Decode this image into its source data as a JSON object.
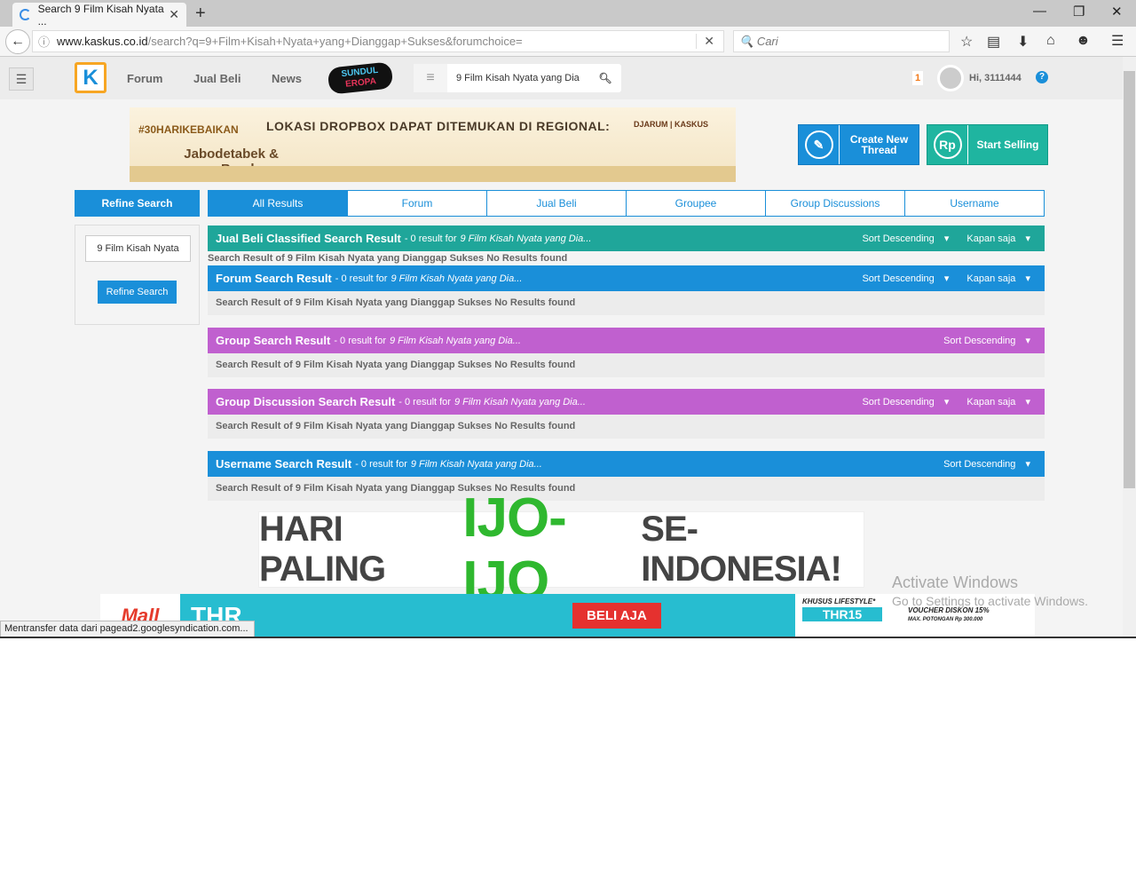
{
  "browser": {
    "tab_title": "Search 9 Film Kisah Nyata ...",
    "url_domain": "www.kaskus.co.id",
    "url_path": "/search?q=9+Film+Kisah+Nyata+yang+Dianggap+Sukses&forumchoice=",
    "search_placeholder": "Cari",
    "status": "Mentransfer data dari pagead2.googlesyndication.com..."
  },
  "header": {
    "nav": [
      "Forum",
      "Jual Beli",
      "News"
    ],
    "promo_logo": "SUNDUL EROPA",
    "search_value": "9 Film Kisah Nyata yang Dia",
    "notif_count": "1",
    "greeting": "Hi, 3111444",
    "help": "?"
  },
  "banner": {
    "tag": "#30HARIKEBAIKAN",
    "headline": "LOKASI DROPBOX DAPAT DITEMUKAN DI REGIONAL:",
    "location": "Jabodetabek & Bandung",
    "sponsor": "DJARUM | KASKUS"
  },
  "actions": {
    "create": "Create New Thread",
    "sell": "Start Selling"
  },
  "refine": {
    "title": "Refine Search",
    "input_value": "9 Film Kisah Nyata",
    "button": "Refine Search"
  },
  "tabs": [
    "All Results",
    "Forum",
    "Jual Beli",
    "Groupee",
    "Group Discussions",
    "Username"
  ],
  "sections": [
    {
      "title": "Jual Beli Classified Search Result",
      "count": "- 0 result for",
      "query": "9 Film Kisah Nyata yang Dia...",
      "sort": "Sort Descending",
      "time": "Kapan saja",
      "body": "Search Result of 9 Film Kisah Nyata yang Dianggap Sukses No Results found",
      "color": "#1fa69a"
    },
    {
      "title": "Forum Search Result",
      "count": "- 0 result for",
      "query": "9 Film Kisah Nyata yang Dia...",
      "sort": "Sort Descending",
      "time": "Kapan saja",
      "body": "Search Result of 9 Film Kisah Nyata yang Dianggap Sukses No Results found",
      "color": "#1a8fd9"
    },
    {
      "title": "Group Search Result",
      "count": "- 0 result for",
      "query": "9 Film Kisah Nyata yang Dia...",
      "sort": "Sort Descending",
      "body": "Search Result of 9 Film Kisah Nyata yang Dianggap Sukses No Results found",
      "color": "#c060cf"
    },
    {
      "title": "Group Discussion Search Result",
      "count": "- 0 result for",
      "query": "9 Film Kisah Nyata yang Dia...",
      "sort": "Sort Descending",
      "time": "Kapan saja",
      "body": "Search Result of 9 Film Kisah Nyata yang Dianggap Sukses No Results found",
      "color": "#c060cf"
    },
    {
      "title": "Username Search Result",
      "count": "- 0 result for",
      "query": "9 Film Kisah Nyata yang Dia...",
      "sort": "Sort Descending",
      "body": "Search Result of 9 Film Kisah Nyata yang Dianggap Sukses No Results found",
      "color": "#1a8fd9"
    }
  ],
  "ad2": {
    "a": "HARI PALING",
    "b": "IJO-IJO",
    "c": "SE-INDONESIA!"
  },
  "bottom_ad": {
    "brand": "Mall",
    "thr": "THR",
    "cta": "BELI AJA",
    "lifestyle": "KHUSUS LIFESTYLE*",
    "code": "THR15",
    "voucher": "VOUCHER DISKON 15%",
    "max": "MAX. POTONGAN Rp 300.000"
  },
  "windows": {
    "activate": "Activate Windows",
    "settings": "Go to Settings to activate Windows."
  }
}
